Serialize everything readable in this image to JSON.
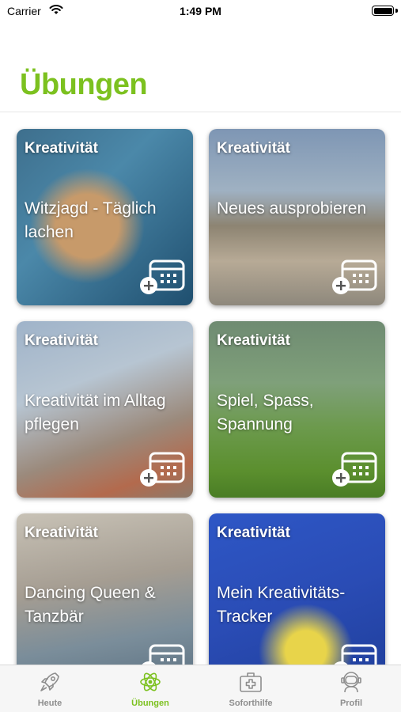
{
  "status_bar": {
    "carrier": "Carrier",
    "time": "1:49 PM"
  },
  "header": {
    "title": "Übungen",
    "title_color": "#7cc11f"
  },
  "cards": [
    {
      "category": "Kreativität",
      "title": "Witzjagd - Täglich lachen",
      "icon": "calendar-add-icon"
    },
    {
      "category": "Kreativität",
      "title": "Neues ausprobieren",
      "icon": "calendar-add-icon"
    },
    {
      "category": "Kreativität",
      "title": "Kreativität im Alltag pflegen",
      "icon": "calendar-add-icon"
    },
    {
      "category": "Kreativität",
      "title": "Spiel, Spass, Spannung",
      "icon": "calendar-add-icon"
    },
    {
      "category": "Kreativität",
      "title": "Dancing Queen & Tanzbär",
      "icon": "calendar-add-icon"
    },
    {
      "category": "Kreativität",
      "title": "Mein Kreativitäts-Tracker",
      "icon": "calendar-add-icon"
    }
  ],
  "tab_bar": {
    "active_color": "#7cc11f",
    "inactive_color": "#8e8e8e",
    "tabs": [
      {
        "label": "Heute",
        "icon": "rocket-icon",
        "active": false
      },
      {
        "label": "Übungen",
        "icon": "atom-icon",
        "active": true
      },
      {
        "label": "Soforthilfe",
        "icon": "first-aid-kit-icon",
        "active": false
      },
      {
        "label": "Profil",
        "icon": "astronaut-icon",
        "active": false
      }
    ]
  }
}
